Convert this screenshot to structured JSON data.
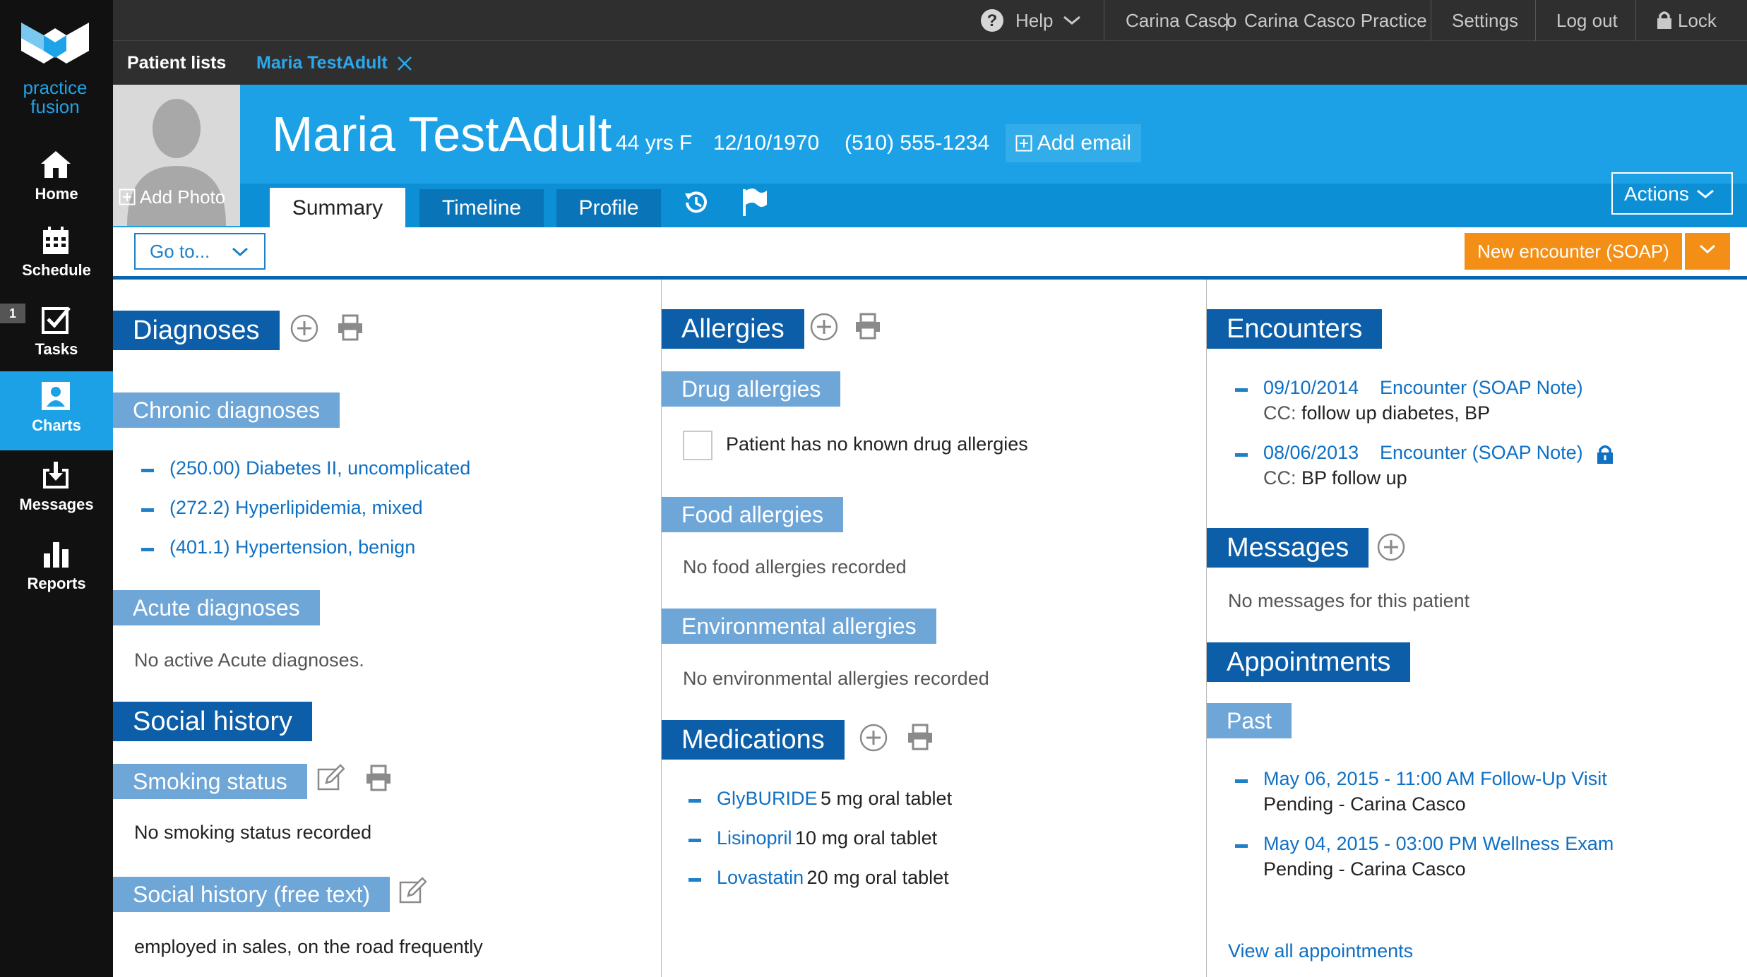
{
  "brand": {
    "line1": "practice",
    "line2": "fusion"
  },
  "nav": {
    "home": "Home",
    "schedule": "Schedule",
    "tasks": "Tasks",
    "tasks_badge": "1",
    "charts": "Charts",
    "messages": "Messages",
    "reports": "Reports"
  },
  "topbar": {
    "help": "Help",
    "user": "Carina Casco",
    "separator": "|",
    "practice": "Carina Casco Practice",
    "settings": "Settings",
    "logout": "Log out",
    "lock": "Lock"
  },
  "tabs": {
    "patient_lists": "Patient lists",
    "current_patient": "Maria TestAdult"
  },
  "patient": {
    "add_photo": "Add Photo",
    "name": "Maria TestAdult",
    "age_sex": "44 yrs F",
    "dob": "12/10/1970",
    "phone": "(510) 555-1234",
    "add_email": "Add email"
  },
  "chart_tabs": {
    "summary": "Summary",
    "timeline": "Timeline",
    "profile": "Profile"
  },
  "actions": "Actions",
  "goto": "Go to...",
  "new_encounter": "New encounter (SOAP)",
  "diagnoses": {
    "title": "Diagnoses",
    "chronic_title": "Chronic diagnoses",
    "chronic": [
      "(250.00) Diabetes II, uncomplicated",
      "(272.2) Hyperlipidemia, mixed",
      "(401.1) Hypertension, benign"
    ],
    "acute_title": "Acute diagnoses",
    "acute_empty": "No active Acute diagnoses."
  },
  "social": {
    "title": "Social history",
    "smoking_title": "Smoking status",
    "smoking_empty": "No smoking status recorded",
    "free_title": "Social history (free text)",
    "free_text": "employed in sales, on the road frequently"
  },
  "allergies": {
    "title": "Allergies",
    "drug_title": "Drug allergies",
    "nkda_label": "Patient has no known drug allergies",
    "food_title": "Food allergies",
    "food_empty": "No food allergies recorded",
    "env_title": "Environmental allergies",
    "env_empty": "No environmental allergies recorded"
  },
  "medications": {
    "title": "Medications",
    "items": [
      {
        "name": "GlyBURIDE",
        "detail": "5 mg oral tablet"
      },
      {
        "name": "Lisinopril",
        "detail": "10 mg oral tablet"
      },
      {
        "name": "Lovastatin",
        "detail": "20 mg oral tablet"
      }
    ]
  },
  "encounters": {
    "title": "Encounters",
    "cc_label": "CC:",
    "items": [
      {
        "date": "09/10/2014",
        "type": "Encounter (SOAP Note)",
        "cc": "follow up diabetes, BP"
      },
      {
        "date": "08/06/2013",
        "type": "Encounter (SOAP Note)",
        "cc": "BP follow up"
      }
    ]
  },
  "messages": {
    "title": "Messages",
    "empty": "No messages for this patient"
  },
  "appointments": {
    "title": "Appointments",
    "past_title": "Past",
    "items": [
      {
        "when": "May 06, 2015 - 11:00 AM Follow-Up Visit",
        "status": "Pending - Carina Casco"
      },
      {
        "when": "May 04, 2015 - 03:00 PM Wellness Exam",
        "status": "Pending - Carina Casco"
      }
    ],
    "view_all": "View all appointments"
  }
}
